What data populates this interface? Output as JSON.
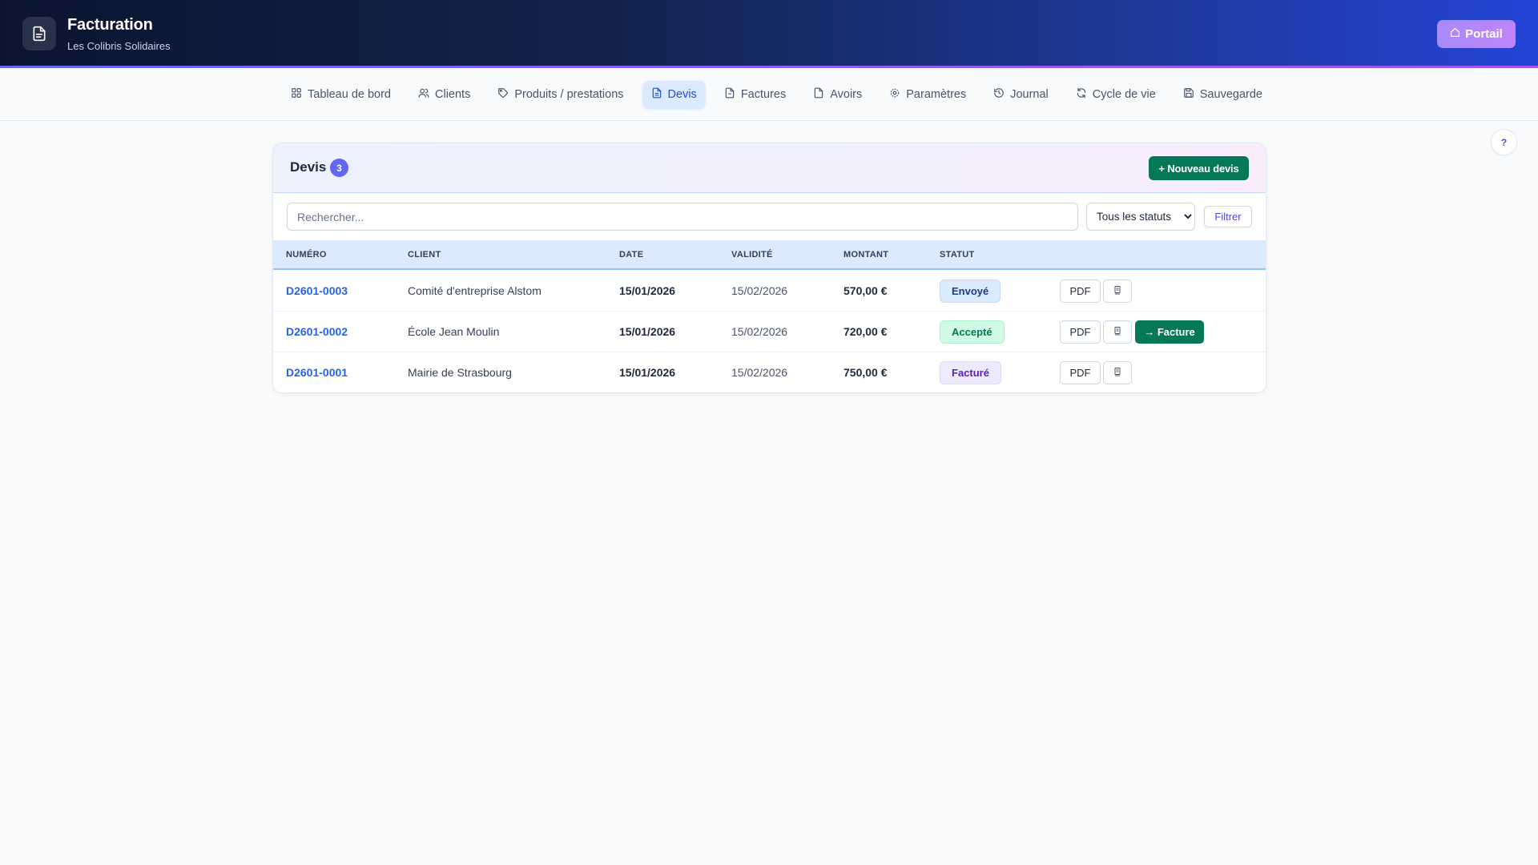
{
  "app": {
    "title": "Facturation",
    "subtitle": "Les Colibris Solidaires",
    "logo_icon": "document-icon",
    "portal_label": "Portail",
    "portal_icon": "home-icon"
  },
  "nav": {
    "items": [
      {
        "label": "Tableau de bord",
        "icon": "dashboard-grid-icon",
        "active": false
      },
      {
        "label": "Clients",
        "icon": "users-icon",
        "active": false
      },
      {
        "label": "Produits / prestations",
        "icon": "tag-icon",
        "active": false
      },
      {
        "label": "Devis",
        "icon": "document-icon",
        "active": true
      },
      {
        "label": "Factures",
        "icon": "invoice-icon",
        "active": false
      },
      {
        "label": "Avoirs",
        "icon": "credit-note-icon",
        "active": false
      },
      {
        "label": "Paramètres",
        "icon": "gear-icon",
        "active": false
      },
      {
        "label": "Journal",
        "icon": "history-icon",
        "active": false
      },
      {
        "label": "Cycle de vie",
        "icon": "refresh-icon",
        "active": false
      },
      {
        "label": "Sauvegarde",
        "icon": "save-icon",
        "active": false
      }
    ]
  },
  "help": {
    "label": "?"
  },
  "quotes": {
    "title": "Devis",
    "count": "3",
    "new_button": "+ Nouveau devis",
    "search_placeholder": "Rechercher...",
    "status_filter": {
      "selected": "Tous les statuts"
    },
    "filter_button": "Filtrer",
    "columns": {
      "number": "NUMÉRO",
      "client": "CLIENT",
      "date": "DATE",
      "validity": "VALIDITÉ",
      "amount": "MONTANT",
      "status": "STATUT"
    },
    "rows": [
      {
        "number": "D2601-0003",
        "client": "Comité d'entreprise Alstom",
        "date": "15/01/2026",
        "validity": "15/02/2026",
        "amount": "570,00 €",
        "status": "Envoyé",
        "pdf": "PDF",
        "convert": ""
      },
      {
        "number": "D2601-0002",
        "client": "École Jean Moulin",
        "date": "15/01/2026",
        "validity": "15/02/2026",
        "amount": "720,00 €",
        "status": "Accepté",
        "pdf": "PDF",
        "convert": "→ Facture"
      },
      {
        "number": "D2601-0001",
        "client": "Mairie de Strasbourg",
        "date": "15/01/2026",
        "validity": "15/02/2026",
        "amount": "750,00 €",
        "status": "Facturé",
        "pdf": "PDF",
        "convert": ""
      }
    ]
  },
  "colors": {
    "accent": "#6366f1",
    "active_nav": "#1d4ed8",
    "primary_action": "#047857",
    "link": "#2563eb"
  }
}
